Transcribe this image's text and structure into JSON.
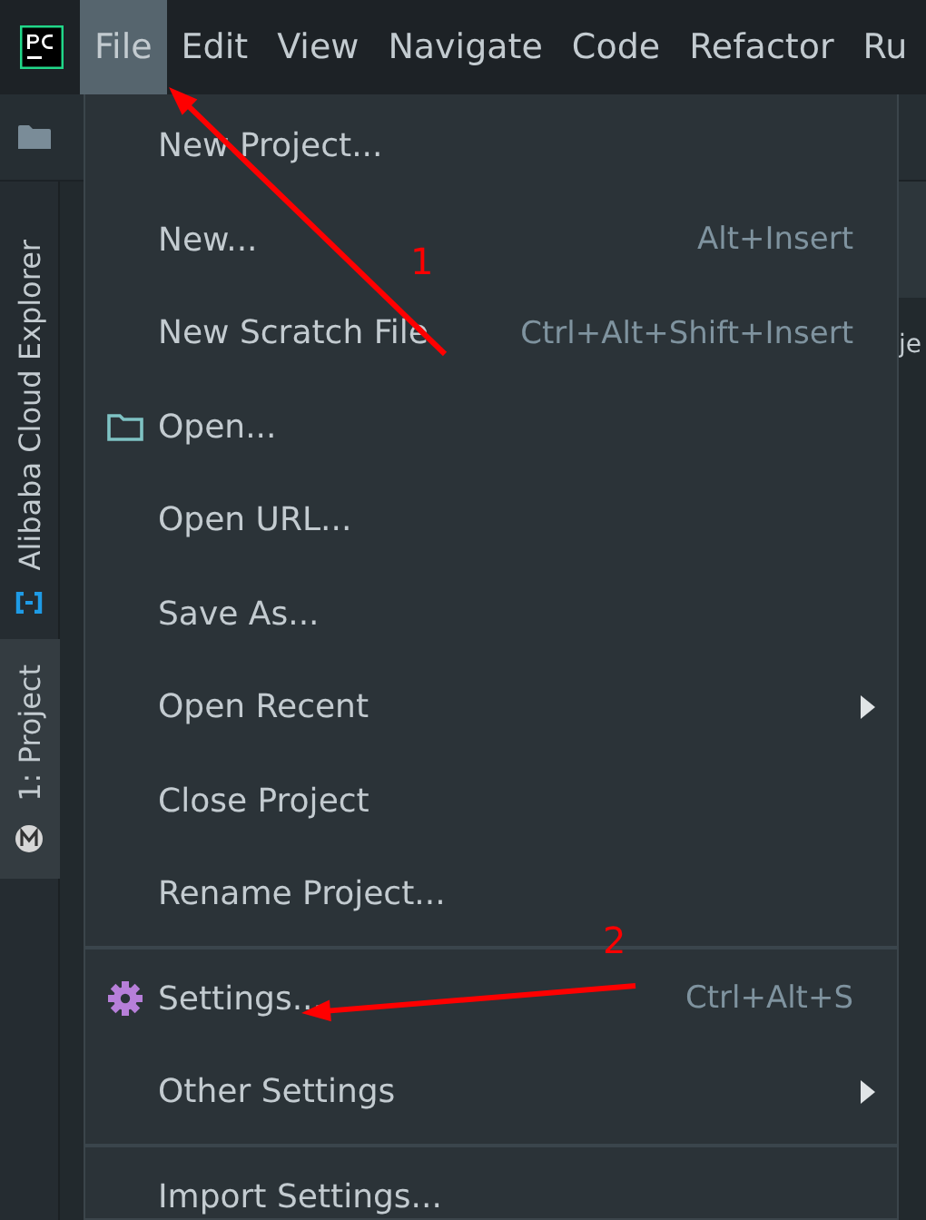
{
  "menubar": {
    "items": [
      {
        "label": "File",
        "selected": true
      },
      {
        "label": "Edit",
        "selected": false
      },
      {
        "label": "View",
        "selected": false
      },
      {
        "label": "Navigate",
        "selected": false
      },
      {
        "label": "Code",
        "selected": false
      },
      {
        "label": "Refactor",
        "selected": false
      },
      {
        "label": "Ru",
        "selected": false
      }
    ]
  },
  "tool_strip": {
    "tabs": [
      {
        "label": "Alibaba Cloud Explorer",
        "selected": false,
        "kind": "cloud"
      },
      {
        "label": "1: Project",
        "selected": true,
        "kind": "project"
      }
    ]
  },
  "editor": {
    "fragment": "je"
  },
  "file_menu": {
    "items": [
      {
        "kind": "item",
        "label": "New Project..."
      },
      {
        "kind": "item",
        "label": "New...",
        "shortcut": "Alt+Insert"
      },
      {
        "kind": "item",
        "label": "New Scratch File",
        "shortcut": "Ctrl+Alt+Shift+Insert"
      },
      {
        "kind": "open",
        "label": "Open..."
      },
      {
        "kind": "item",
        "label": "Open URL..."
      },
      {
        "kind": "item",
        "label": "Save As..."
      },
      {
        "kind": "submenu",
        "label": "Open Recent"
      },
      {
        "kind": "item",
        "label": "Close Project"
      },
      {
        "kind": "item",
        "label": "Rename Project..."
      },
      {
        "kind": "separator"
      },
      {
        "kind": "settings",
        "label": "Settings...",
        "shortcut": "Ctrl+Alt+S"
      },
      {
        "kind": "submenu",
        "label": "Other Settings"
      },
      {
        "kind": "separator"
      },
      {
        "kind": "item",
        "label": "Import Settings..."
      }
    ]
  },
  "annotations": [
    {
      "label": "1"
    },
    {
      "label": "2"
    }
  ]
}
